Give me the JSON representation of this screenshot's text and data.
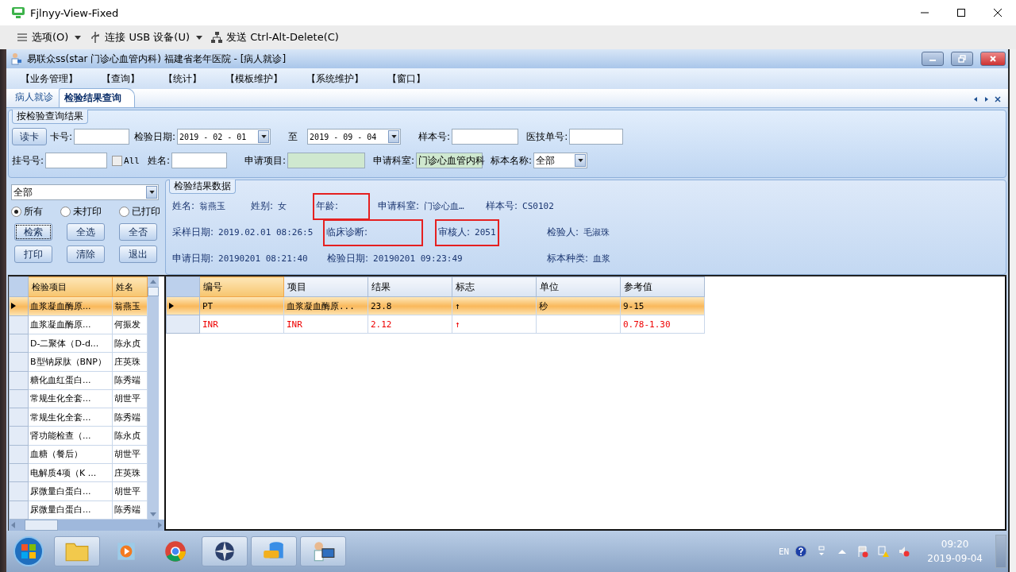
{
  "viewer": {
    "title": "Fjlnyy-View-Fixed",
    "toolbar": [
      {
        "kind": "menu",
        "label": "选项(O)",
        "dropdown": true
      },
      {
        "kind": "usb",
        "label": "连接 USB 设备(U)",
        "dropdown": true
      },
      {
        "kind": "network",
        "label": "发送 Ctrl-Alt-Delete(C)",
        "dropdown": false
      }
    ]
  },
  "app": {
    "title": "易联众ss(star 门诊心血管内科) 福建省老年医院 - [病人就诊]",
    "menu": [
      "【业务管理】",
      "【查询】",
      "【统计】",
      "【模板维护】",
      "【系统维护】",
      "【窗口】"
    ],
    "tabs": [
      {
        "label": "病人就诊",
        "selected": false
      },
      {
        "label": "检验结果查询",
        "selected": true
      }
    ]
  },
  "query": {
    "legend": "按检验查询结果",
    "read_card": "读卡",
    "card_no": {
      "label": "卡号:"
    },
    "date_from": {
      "label": "检验日期:",
      "value": "2019 - 02 - 01"
    },
    "date_to": {
      "label": "至",
      "value": "2019 - 09 - 04"
    },
    "sample_no": {
      "label": "样本号:"
    },
    "tech_no": {
      "label": "医技单号:"
    },
    "reg_no": {
      "label": "挂号号:"
    },
    "all": {
      "label": "All",
      "checked": false
    },
    "name": {
      "label": "姓名:"
    },
    "item": {
      "label": "申请项目:"
    },
    "dept": {
      "label": "申请科室:",
      "value": "门诊心血管内科"
    },
    "specimen": {
      "label": "标本名称:",
      "value": "全部"
    }
  },
  "filter": {
    "value": "全部",
    "radios": [
      {
        "label": "所有",
        "selected": true
      },
      {
        "label": "未打印",
        "selected": false
      },
      {
        "label": "已打印",
        "selected": false
      }
    ],
    "buttons": [
      "检索",
      "全选",
      "全否",
      "打印",
      "清除",
      "退出"
    ]
  },
  "result_info": {
    "legend": "检验结果数据",
    "fields": [
      {
        "label": "姓名:",
        "value": "翁燕玉",
        "highlighted": false
      },
      {
        "label": "姓别:",
        "value": "女",
        "highlighted": false
      },
      {
        "label": "年龄:",
        "highlighted": true
      },
      {
        "label": "申请科室:",
        "value": "门诊心血…",
        "highlighted": false
      },
      {
        "label": "样本号:",
        "value": "CS0102",
        "highlighted": false
      },
      {
        "label": "采样日期:",
        "value": "2019.02.01 08:26:5",
        "highlighted": false
      },
      {
        "label": "临床诊断:",
        "highlighted": true
      },
      {
        "label": "审核人:",
        "value": "2051",
        "highlighted": true
      },
      {
        "label": "检验人:",
        "value": "毛淑珠",
        "highlighted": false
      },
      {
        "label": "申请日期:",
        "value": "20190201 08:21:40",
        "highlighted": false
      },
      {
        "label": "检验日期:",
        "value": "20190201 09:23:49",
        "highlighted": false
      },
      {
        "label": "标本种类:",
        "value": "血浆",
        "highlighted": false
      }
    ]
  },
  "orders": {
    "columns": [
      "检验项目",
      "姓名"
    ],
    "rows": [
      {
        "item": "血浆凝血酶原...",
        "name": "翁燕玉",
        "selected": true
      },
      {
        "item": "血浆凝血酶原...",
        "name": "何振发",
        "selected": false
      },
      {
        "item": "D-二聚体（D-d...",
        "name": "陈永贞",
        "selected": false
      },
      {
        "item": "B型钠尿肽（BNP）",
        "name": "庄英珠",
        "selected": false
      },
      {
        "item": "糖化血红蛋白...",
        "name": "陈秀端",
        "selected": false
      },
      {
        "item": "常规生化全套...",
        "name": "胡世平",
        "selected": false
      },
      {
        "item": "常规生化全套...",
        "name": "陈秀端",
        "selected": false
      },
      {
        "item": "肾功能检查（...",
        "name": "陈永贞",
        "selected": false
      },
      {
        "item": "血糖（餐后）",
        "name": "胡世平",
        "selected": false
      },
      {
        "item": "电解质4项（K ...",
        "name": "庄英珠",
        "selected": false
      },
      {
        "item": "尿微量白蛋白...",
        "name": "胡世平",
        "selected": false
      },
      {
        "item": "尿微量白蛋白...",
        "name": "陈秀端",
        "selected": false
      }
    ]
  },
  "results": {
    "columns": [
      "编号",
      "项目",
      "结果",
      "标志",
      "单位",
      "参考值"
    ],
    "rows": [
      {
        "cells": [
          "PT",
          "血浆凝血酶原...",
          "23.8",
          "↑",
          "秒",
          "9-15"
        ],
        "selected": true,
        "red_text": false
      },
      {
        "cells": [
          "INR",
          "INR",
          "2.12",
          "↑",
          "",
          "0.78-1.30"
        ],
        "selected": false,
        "red_text": true
      }
    ]
  },
  "taskbar": {
    "apps": [
      {
        "kind": "folder",
        "active": true
      },
      {
        "kind": "media",
        "active": false
      },
      {
        "kind": "chrome",
        "active": false
      },
      {
        "kind": "compass",
        "active": true
      },
      {
        "kind": "sql",
        "active": true
      },
      {
        "kind": "doctor",
        "active": true
      }
    ],
    "language": "EN",
    "time": "09:20",
    "date": "2019-09-04"
  }
}
